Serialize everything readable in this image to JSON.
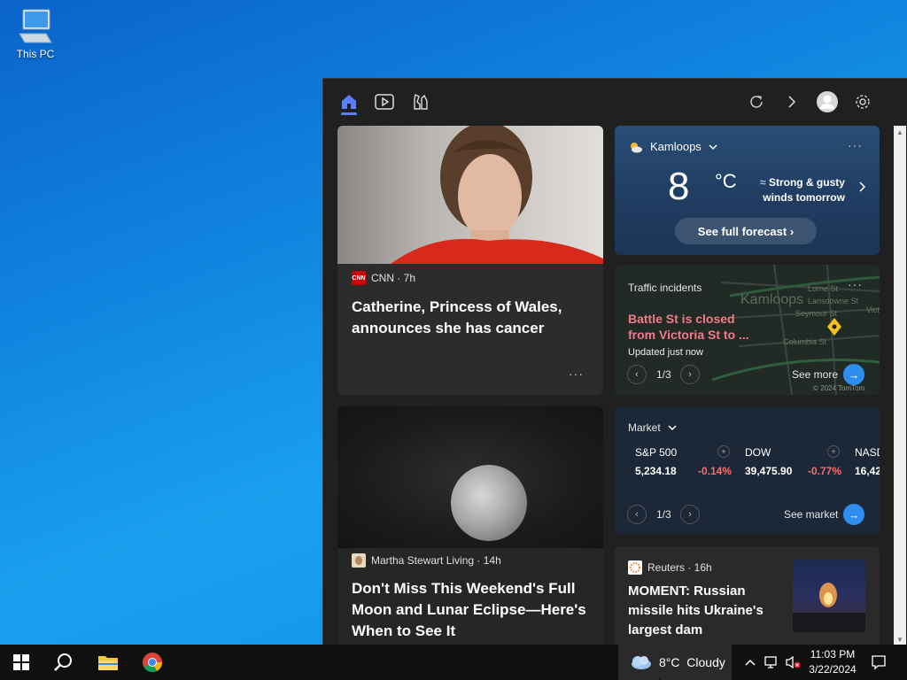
{
  "desktop": {
    "this_pc_label": "This PC"
  },
  "weather": {
    "location": "Kamloops",
    "temp": "8",
    "unit": "°C",
    "alert_line1": "Strong & gusty",
    "alert_line2": "winds tomorrow",
    "forecast_button": "See full forecast"
  },
  "news1": {
    "source": "CNN",
    "source_logo": "CNN",
    "meta": "CNN · 7h",
    "headline_line1": "Catherine, Princess of Wales,",
    "headline_line2": "announces she has cancer"
  },
  "news2": {
    "meta": "Martha Stewart Living · 14h",
    "headline_line1": "Don't Miss This Weekend's Full",
    "headline_line2": "Moon and Lunar Eclipse—Here's",
    "headline_line3": "When to See It"
  },
  "traffic": {
    "title": "Traffic incidents",
    "incident_line1": "Battle St is closed",
    "incident_line2": "from Victoria St to ...",
    "updated": "Updated just now",
    "pager": "1/3",
    "see_more": "See more",
    "map_city": "Kamloops",
    "map_streets": [
      "Lorne St",
      "Lansdowne St",
      "Seymour St",
      "Columbia St",
      "Vict"
    ],
    "map_credit": "© 2024 TomTom"
  },
  "market": {
    "title": "Market",
    "stocks": [
      {
        "name": "S&P 500",
        "value": "5,234.18",
        "change": "-0.14%"
      },
      {
        "name": "DOW",
        "value": "39,475.90",
        "change": "-0.77%"
      },
      {
        "name": "NASD",
        "value": "16,42"
      }
    ],
    "pager": "1/3",
    "see_market": "See market"
  },
  "news3": {
    "meta": "Reuters · 16h",
    "headline_line1": "MOMENT: Russian",
    "headline_line2": "missile hits Ukraine's",
    "headline_line3": "largest dam"
  },
  "taskbar": {
    "weather": "8°C  Cloudy",
    "time": "11:03 PM",
    "date": "3/22/2024"
  },
  "colors": {
    "accent": "#5b7ff7",
    "negative": "#ff6a6a",
    "traffic_red": "#f17a8a",
    "blue_button": "#2d8ef0"
  }
}
